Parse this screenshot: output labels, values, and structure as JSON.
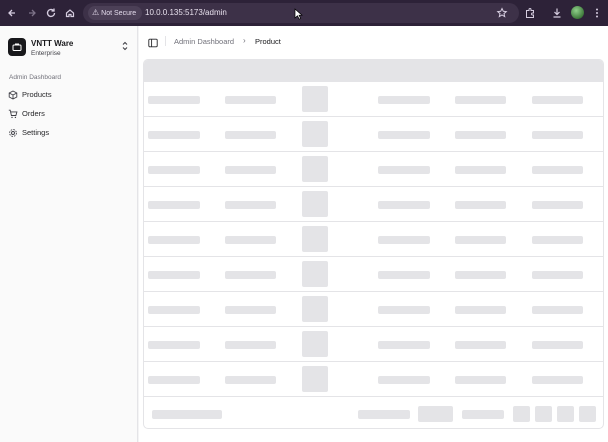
{
  "browser": {
    "security_label": "Not Secure",
    "url": "10.0.0.135:5173/admin"
  },
  "sidebar": {
    "team_name": "VNTT Ware",
    "team_plan": "Enterprise",
    "group_label": "Admin Dashboard",
    "items": [
      {
        "label": "Products",
        "icon": "package-icon"
      },
      {
        "label": "Orders",
        "icon": "cart-icon"
      },
      {
        "label": "Settings",
        "icon": "gear-icon"
      }
    ]
  },
  "header": {
    "breadcrumb": [
      "Admin Dashboard",
      "Product"
    ]
  },
  "table": {
    "loading": true,
    "skeleton_rows": 9
  },
  "colors": {
    "chrome": "#2d2238",
    "skeleton": "#e4e4e7",
    "sidebar_bg": "#fafafa"
  }
}
